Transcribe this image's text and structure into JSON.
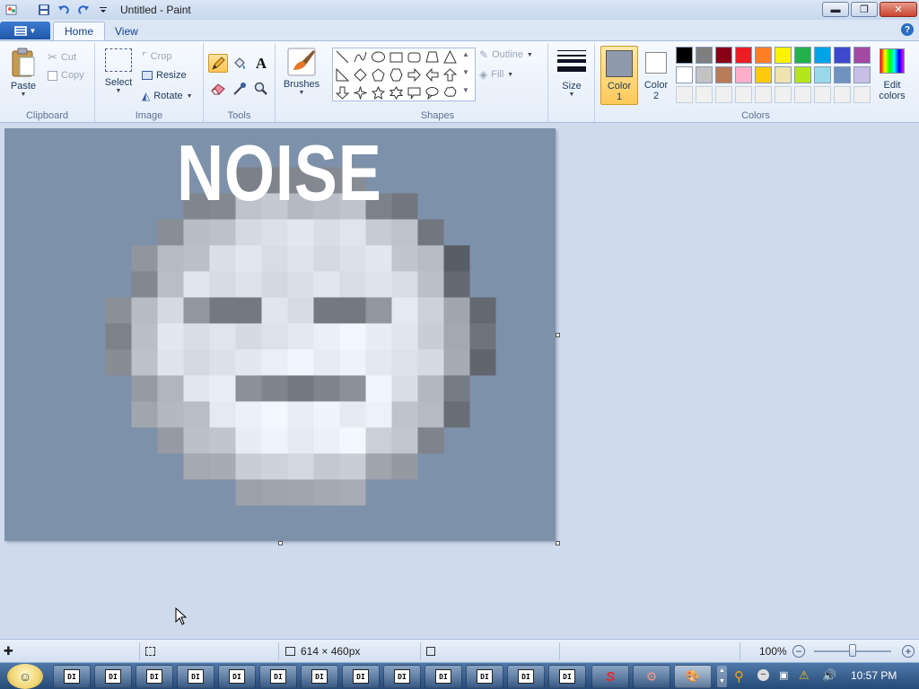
{
  "window": {
    "title": "Untitled - Paint",
    "controls": [
      "minimize",
      "restore",
      "close"
    ]
  },
  "tabs": [
    {
      "label": "Home",
      "active": true
    },
    {
      "label": "View",
      "active": false
    }
  ],
  "ribbon": {
    "clipboard": {
      "label": "Clipboard",
      "paste": "Paste",
      "cut": "Cut",
      "copy": "Copy"
    },
    "image": {
      "label": "Image",
      "select": "Select",
      "crop": "Crop",
      "resize": "Resize",
      "rotate": "Rotate"
    },
    "tools": {
      "label": "Tools",
      "active_tool": "pencil-icon"
    },
    "brushes": {
      "label": "Brushes"
    },
    "shapes": {
      "label": "Shapes",
      "outline": "Outline",
      "fill": "Fill"
    },
    "size": {
      "label": "Size"
    },
    "colors": {
      "label": "Colors",
      "color1_line1": "Color",
      "color1_line2": "1",
      "color2_line1": "Color",
      "color2_line2": "2",
      "edit_line1": "Edit",
      "edit_line2": "colors",
      "color1_value": "#8e9aac",
      "color2_value": "#ffffff",
      "palette_row1": [
        "#000000",
        "#7f7f7f",
        "#880015",
        "#ed1c24",
        "#ff7f27",
        "#fff200",
        "#22b14c",
        "#00a2e8",
        "#3f48cc",
        "#a349a4"
      ],
      "palette_row2": [
        "#ffffff",
        "#c3c3c3",
        "#b97a57",
        "#ffaec9",
        "#ffc90e",
        "#efe4b0",
        "#b5e61d",
        "#99d9ea",
        "#7092be",
        "#c8bfe7"
      ],
      "palette_row3": [
        "#f0f0f0",
        "#f0f0f0",
        "#f0f0f0",
        "#f0f0f0",
        "#f0f0f0",
        "#f0f0f0",
        "#f0f0f0",
        "#f0f0f0",
        "#f0f0f0",
        "#f0f0f0"
      ]
    }
  },
  "canvas": {
    "background": "#7d91aa",
    "title_text": "NOISE"
  },
  "statusbar": {
    "image_size": "614 × 460px",
    "zoom": "100%"
  },
  "taskbar": {
    "task_label": "DI",
    "task_count": 13,
    "clock": "10:57 PM"
  }
}
